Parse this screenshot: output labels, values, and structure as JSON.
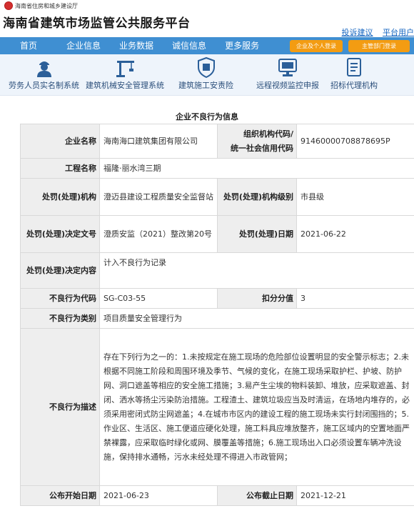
{
  "header": {
    "ministry": "海南省住房和城乡建设厅",
    "title": "海南省建筑市场监管公共服务平台",
    "links": [
      "投诉建议",
      "平台用户"
    ]
  },
  "nav": {
    "items": [
      "首页",
      "企业信息",
      "业务数据",
      "诚信信息",
      "更多服务"
    ],
    "personal_login": "企业及个人登录",
    "dept_login": "主管部门登录"
  },
  "icons": [
    {
      "label": "劳务人员实名制系统",
      "icon": "worker-icon"
    },
    {
      "label": "建筑机械安全管理系统",
      "icon": "crane-icon"
    },
    {
      "label": "建筑施工安责险",
      "icon": "shield-icon"
    },
    {
      "label": "远程视频监控申报",
      "icon": "monitor-icon"
    },
    {
      "label": "招标代理机构",
      "icon": "document-icon"
    }
  ],
  "section_title": "企业不良行为信息",
  "record": {
    "labels": {
      "company": "企业名称",
      "org_code_1": "组织机构代码/",
      "org_code_2": "统一社会信用代码",
      "project": "工程名称",
      "authority": "处罚(处理)机构",
      "authority_level": "处罚(处理)机构级别",
      "decision_no": "处罚(处理)决定文号",
      "decision_date": "处罚(处理)日期",
      "decision_content": "处罚(处理)决定内容",
      "behavior_code": "不良行为代码",
      "deduction": "扣分分值",
      "category": "不良行为类别",
      "description": "不良行为描述",
      "publish_start": "公布开始日期",
      "publish_end": "公布截止日期"
    },
    "values": {
      "company": "海南海口建筑集团有限公司",
      "org_code": "91460000708878695P",
      "project": "福隆·丽水湾三期",
      "authority": "澄迈县建设工程质量安全监督站",
      "authority_level": "市县级",
      "decision_no": "澄质安监（2021）整改第20号",
      "decision_date": "2021-06-22",
      "decision_content": "计入不良行为记录",
      "behavior_code": "SG-C03-55",
      "deduction": "3",
      "category": "项目质量安全管理行为",
      "description": "存在下列行为之一的：1.未按规定在施工现场的危险部位设置明显的安全警示标志；2.未根据不同施工阶段和周围环境及季节、气候的变化，在施工现场采取护栏、护坡、防护网、洞口遮盖等相应的安全施工措施；3.易产生尘埃的物料装卸、堆放，应采取遮盖、封闭、洒水等扬尘污染防治措施。工程渣土、建筑垃圾应当及时清运，在场地内堆存的，必须采用密闭式防尘网遮盖；4.在城市市区内的建设工程的施工现场未实行封闭围挡的；5.作业区、生活区、施工便道应硬化处理，施工料具应堆放整齐，施工区域内的空置地面严禁裸露，应采取临时绿化或网、膜覆盖等措施；6.施工现场出入口必须设置车辆冲洗设施，保持排水通畅，污水未经处理不得进入市政管网；",
      "publish_start": "2021-06-23",
      "publish_end": "2021-12-21"
    }
  },
  "colors": {
    "nav_blue": "#3f8fd2",
    "login_orange": "#f39c12",
    "label_bg": "#eeeeee",
    "link_blue": "#1565c0"
  }
}
